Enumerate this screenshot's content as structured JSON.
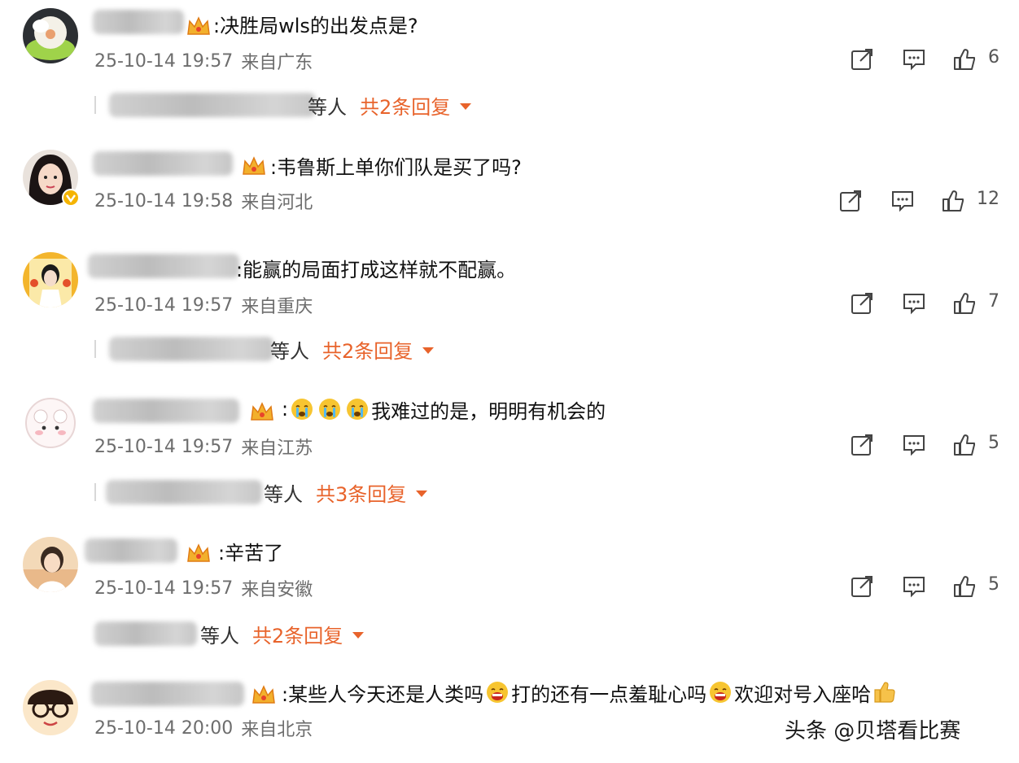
{
  "comments": [
    {
      "text": ":决胜局wls的出发点是?",
      "time": "25-10-14 19:57",
      "location": "来自广东",
      "likes": "6",
      "reply": {
        "who": "等人",
        "count": "共2条回复"
      }
    },
    {
      "text": ":韦鲁斯上单你们队是买了吗?",
      "time": "25-10-14 19:58",
      "location": "来自河北",
      "likes": "12"
    },
    {
      "text": ":能赢的局面打成这样就不配赢。",
      "time": "25-10-14 19:57",
      "location": "来自重庆",
      "likes": "7",
      "reply": {
        "who": "等人",
        "count": "共2条回复"
      }
    },
    {
      "text_prefix": ":",
      "text": "我难过的是，明明有机会的",
      "time": "25-10-14 19:57",
      "location": "来自江苏",
      "likes": "5",
      "reply": {
        "who": "等人",
        "count": "共3条回复"
      }
    },
    {
      "text": ":辛苦了",
      "time": "25-10-14 19:57",
      "location": "来自安徽",
      "likes": "5",
      "reply": {
        "who": "等人",
        "count": "共2条回复"
      }
    },
    {
      "text_a": ":某些人今天还是人类吗",
      "text_b": "打的还有一点羞耻心吗",
      "text_c": "欢迎对号入座哈",
      "time": "25-10-14 20:00",
      "location": "来自北京"
    }
  ],
  "watermark": "头条 @贝塔看比赛",
  "icons": {
    "share": "share-icon",
    "comment": "comment-icon",
    "like": "thumbs-up-icon",
    "crown": "crown-badge-icon",
    "cry": "crying-emoji-icon",
    "thumb": "thumbs-up-emoji-icon"
  },
  "colors": {
    "reply_accent": "#e8632b",
    "meta": "#6d6d6d"
  }
}
